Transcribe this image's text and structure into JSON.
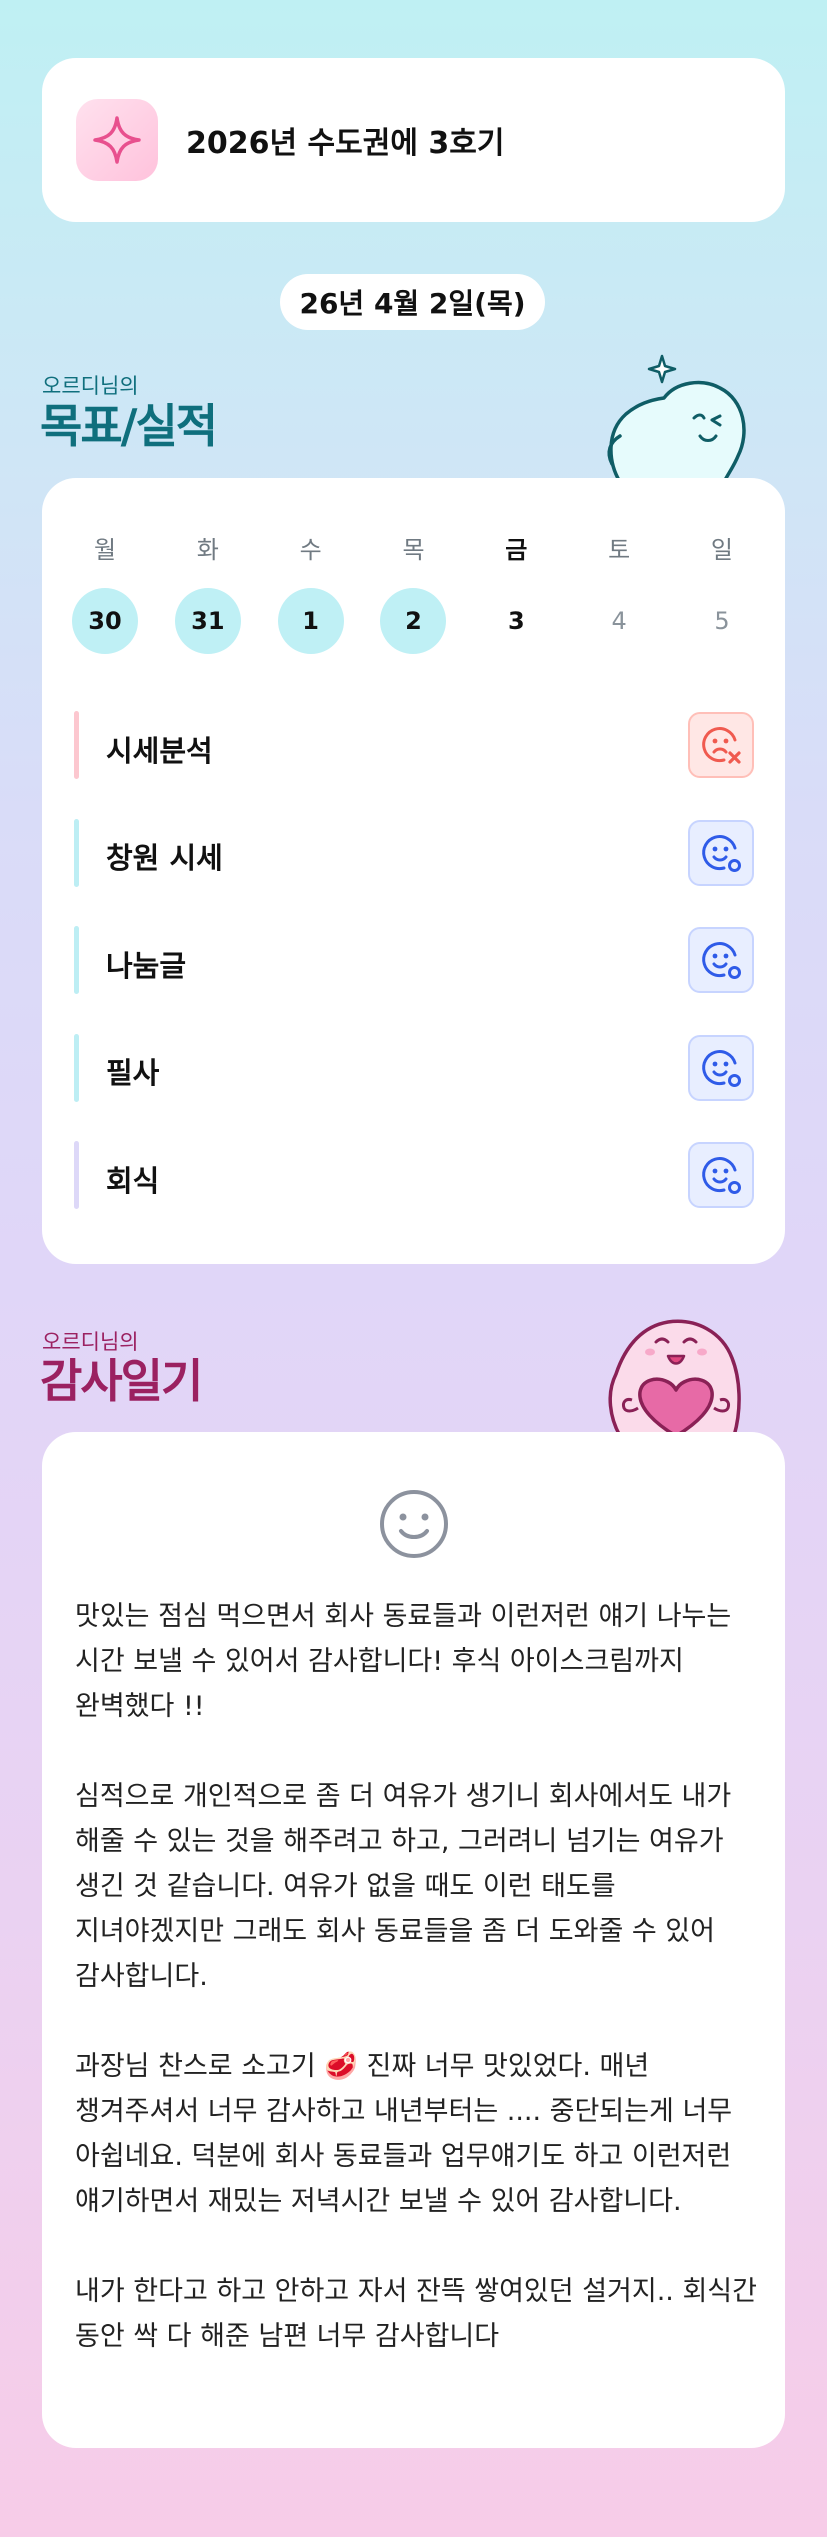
{
  "goal": {
    "icon": "sparkle-icon",
    "title": "2026년 수도권에 3호기"
  },
  "date": "26년 4월 2일(목)",
  "goals_section": {
    "subtitle": "오르디님의",
    "title": "목표/실적"
  },
  "week": {
    "days": [
      {
        "name": "월",
        "num": "30"
      },
      {
        "name": "화",
        "num": "31"
      },
      {
        "name": "수",
        "num": "1"
      },
      {
        "name": "목",
        "num": "2"
      },
      {
        "name": "금",
        "num": "3"
      },
      {
        "name": "토",
        "num": "4"
      },
      {
        "name": "일",
        "num": "5"
      }
    ]
  },
  "tasks": [
    {
      "label": "시세분석",
      "status": "fail",
      "bar_color": "#fcc7cf"
    },
    {
      "label": "창원 시세",
      "status": "done",
      "bar_color": "#bdeef4"
    },
    {
      "label": "나눔글",
      "status": "done",
      "bar_color": "#bdeef4"
    },
    {
      "label": "필사",
      "status": "done",
      "bar_color": "#bdeef4"
    },
    {
      "label": "회식",
      "status": "done",
      "bar_color": "#ddd8f8"
    }
  ],
  "gratitude_section": {
    "subtitle": "오르디님의",
    "title": "감사일기"
  },
  "gratitude": {
    "icon": "smile-face-icon",
    "paragraphs": [
      "맛있는 점심 먹으면서 회사 동료들과 이런저런 얘기 나누는 시간 보낼 수 있어서 감사합니다! 후식 아이스크림까지 완벽했다 !!",
      "심적으로 개인적으로 좀 더 여유가 생기니 회사에서도 내가 해줄 수 있는 것을 해주려고 하고, 그러려니 넘기는 여유가 생긴 것 같습니다. 여유가 없을 때도 이런 태도를 지녀야겠지만 그래도 회사 동료들을 좀 더 도와줄 수 있어 감사합니다.",
      "과장님 찬스로 소고기 🥩 진짜 너무 맛있었다. 매년 챙겨주셔서 너무 감사하고 내년부터는 .... 중단되는게 너무 아쉽네요. 덕분에 회사 동료들과 업무얘기도 하고 이런저런 얘기하면서 재밌는 저녁시간 보낼 수 있어 감사합니다.",
      "내가 한다고 하고 안하고 자서 잔뜩 쌓여있던 설거지.. 회식간 동안 싹 다 해준 남편 너무 감사합니다"
    ]
  },
  "colors": {
    "teal_heading": "#0f6f7d",
    "pink_heading": "#9b2161",
    "done_day_bg": "#bff0f5",
    "fail_icon": "#f05a4f",
    "ok_icon": "#2f5be8"
  }
}
